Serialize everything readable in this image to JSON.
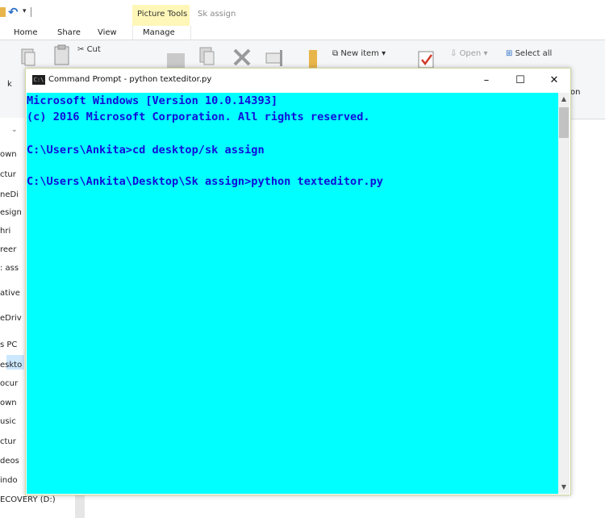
{
  "explorer": {
    "window_title": "Sk assign",
    "contextual_group": "Picture Tools",
    "tabs": [
      "Home",
      "Share",
      "View",
      "Manage"
    ],
    "ribbon": {
      "cut": "Cut",
      "new_item": "New item ▾",
      "open": "Open ▾",
      "select_all": "Select all",
      "partial_left": "k",
      "partial_right": "on"
    },
    "nav_items": [
      "own",
      "ctur",
      "neDi",
      "esign",
      "hri",
      "reer",
      ": ass",
      "ative",
      "eDriv",
      "s PC",
      "eskto",
      "ocur",
      "own",
      "usic",
      "ctur",
      "deos",
      "indo",
      "ECOVERY (D:)"
    ]
  },
  "cmd": {
    "title": "Command Prompt - python  texteditor.py",
    "icon_text": "C:\\",
    "minimize": "–",
    "maximize": "☐",
    "close": "✕",
    "lines": [
      "Microsoft Windows [Version 10.0.14393]",
      "(c) 2016 Microsoft Corporation. All rights reserved.",
      "C:\\Users\\Ankita>cd desktop/sk assign",
      "C:\\Users\\Ankita\\Desktop\\Sk assign>python texteditor.py"
    ],
    "colors": {
      "background": "#00ffff",
      "text": "#1010d8"
    }
  }
}
